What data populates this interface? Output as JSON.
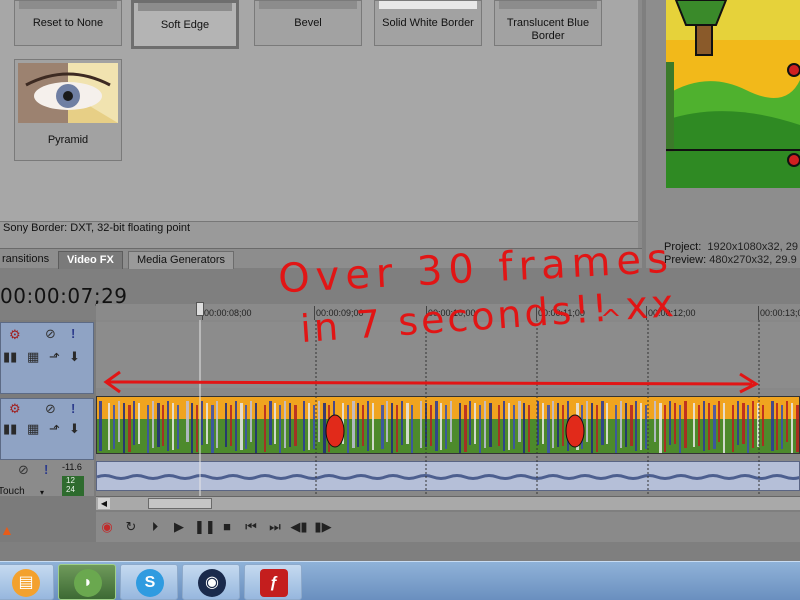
{
  "fx_browser": {
    "tiles": [
      {
        "label": "Reset to None"
      },
      {
        "label": "Soft Edge"
      },
      {
        "label": "Bevel"
      },
      {
        "label": "Solid White Border"
      },
      {
        "label": "Translucent Blue Border"
      },
      {
        "label": "Pyramid"
      }
    ],
    "status": "Sony Border: DXT, 32-bit floating point",
    "tabs": [
      "ransitions",
      "Video FX",
      "Media Generators"
    ]
  },
  "preview": {
    "project_label": "Project:",
    "project_value": "1920x1080x32, 29",
    "preview_label": "Preview:",
    "preview_value": "480x270x32, 29.9"
  },
  "timeline": {
    "timecode": "00:00:07;29",
    "ruler": [
      "00:00:08;00",
      "00:00:09;00",
      "00:00:10;00",
      "00:00:11;00",
      "00:00:12;00",
      "00:00:13;0"
    ],
    "audio_level": "-11.6",
    "audio_mode": "Touch",
    "meter_values": [
      "12",
      "24"
    ]
  },
  "annotation": {
    "line1": "Over 30 frames",
    "line2": "in 7 seconds!! xx",
    "face": "^"
  },
  "taskbar": {
    "apps": [
      "ie-icon",
      "sony-vegas-icon",
      "skype-icon",
      "webcam-icon",
      "flash-icon"
    ]
  },
  "colors": {
    "annotation": "#e11515",
    "track_header": "#8fa3c4",
    "taskbar": "#7aa0cd"
  }
}
